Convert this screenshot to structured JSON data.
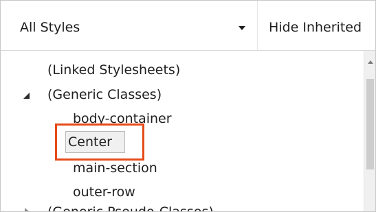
{
  "toolbar": {
    "style_filter": "All Styles",
    "hide_inherited_label": "Hide Inherited"
  },
  "tree": {
    "linked_stylesheets": "(Linked Stylesheets)",
    "generic_classes": {
      "label": "(Generic Classes)",
      "expanded": true,
      "children": [
        "body-container",
        "Center",
        "main-section",
        "outer-row"
      ],
      "selected": "Center"
    },
    "next_group_label": "(Generic Pseudo-Classes)"
  },
  "colors": {
    "highlight": "#e64a19",
    "selection": "#f0f0f0"
  }
}
